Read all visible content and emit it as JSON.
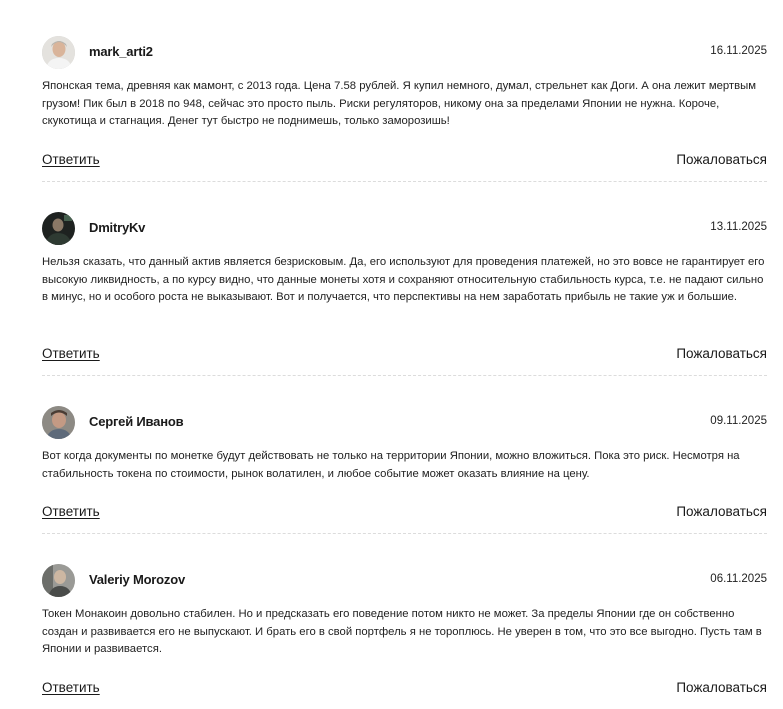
{
  "comments": [
    {
      "author": "mark_arti2",
      "date": "16.11.2025",
      "text": "Японская тема, древняя как мамонт, с 2013 года. Цена 7.58 рублей. Я купил немного, думал, стрельнет как Доги. А она лежит мертвым грузом! Пик был в 2018 по 948, сейчас это просто пыль. Риски регуляторов, никому она за пределами Японии не нужна. Короче, скукотища и стагнация. Денег тут быстро не поднимешь, только заморозишь!",
      "reply_label": "Ответить",
      "report_label": "Пожаловаться",
      "avatar_icon": "user-photo-avatar"
    },
    {
      "author": "DmitryKv",
      "date": "13.11.2025",
      "text": "Нельзя сказать, что данный актив является безрисковым. Да, его используют для проведения платежей, но это вовсе не гарантирует его высокую ликвидность, а по курсу видно, что данные монеты хотя и сохраняют относительную стабильность курса, т.е. не падают сильно в минус, но и особого роста не выказывают. Вот и получается, что перспективы на нем заработать прибыль не такие уж и большие.",
      "reply_label": "Ответить",
      "report_label": "Пожаловаться",
      "avatar_icon": "user-photo-avatar"
    },
    {
      "author": "Сергей Иванов",
      "date": "09.11.2025",
      "text": "Вот когда документы по монетке будут действовать не только на территории Японии, можно вложиться. Пока это риск. Несмотря на стабильность токена по стоимости, рынок волатилен, и любое событие может оказать влияние на цену.",
      "reply_label": "Ответить",
      "report_label": "Пожаловаться",
      "avatar_icon": "user-photo-avatar"
    },
    {
      "author": "Valeriy Morozov",
      "date": "06.11.2025",
      "text": "Токен Монакоин довольно стабилен. Но и предсказать его поведение потом никто не может. За пределы Японии где он собственно создан и развивается его не выпускают. И брать его в свой портфель я не тороплюсь. Не уверен в том, что это все выгодно. Пусть там в Японии и развивается.",
      "reply_label": "Ответить",
      "report_label": "Пожаловаться",
      "avatar_icon": "user-photo-avatar"
    }
  ],
  "colors": {
    "text": "#222222",
    "divider": "#dcdcdc",
    "background": "#ffffff"
  }
}
